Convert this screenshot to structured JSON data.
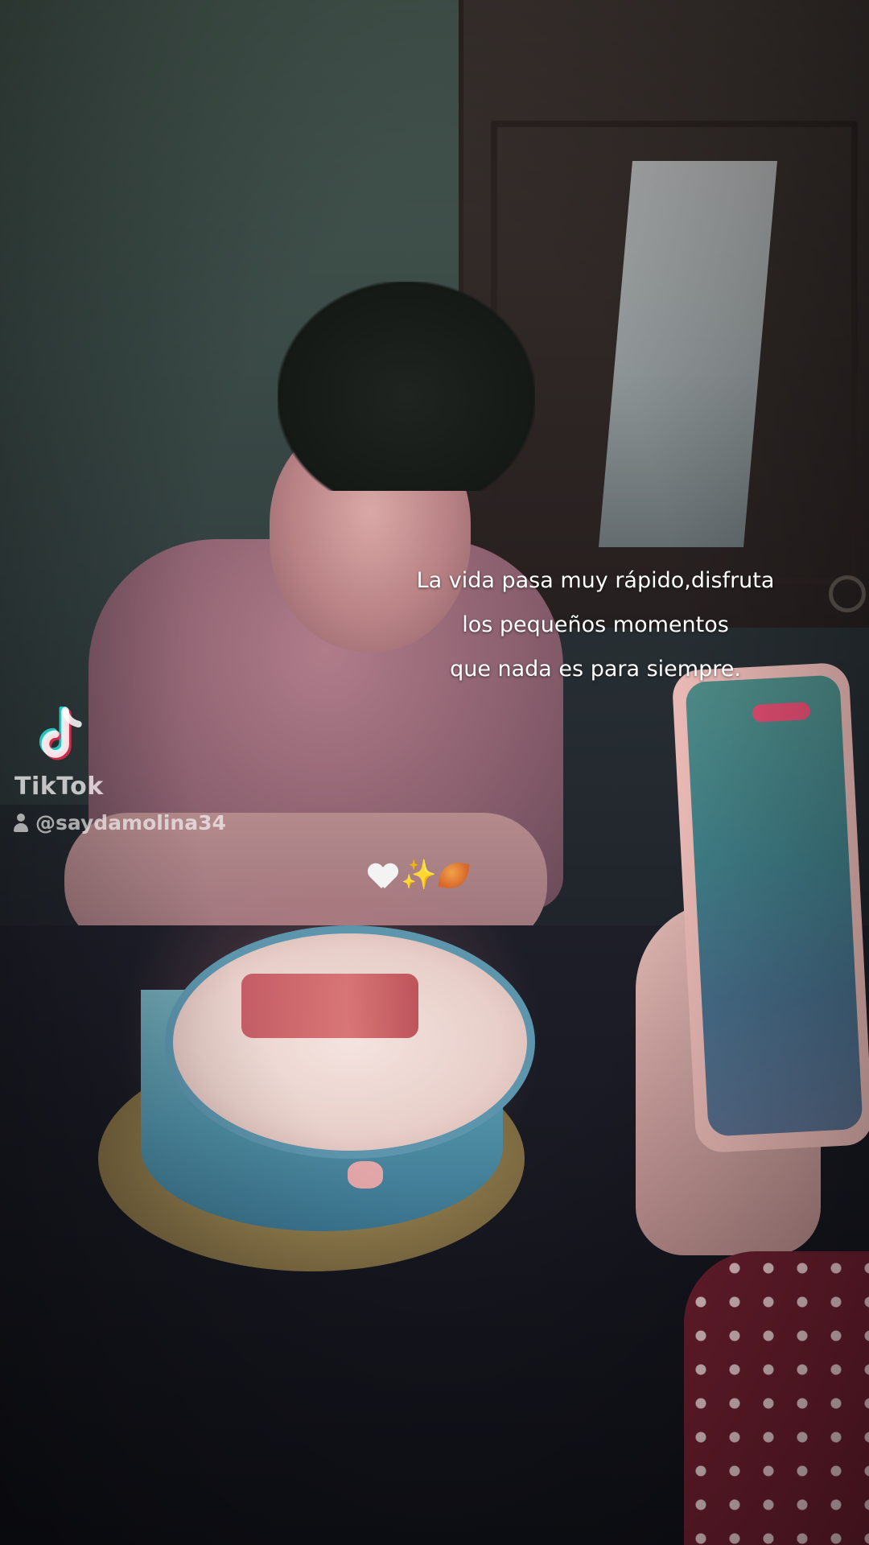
{
  "caption": {
    "lines": [
      "La vida pasa muy rápido,disfruta",
      "los pequeños momentos",
      "que nada es para siempre."
    ]
  },
  "emojis": [
    "white-heart",
    "sparkles",
    "fallen-leaf"
  ],
  "watermark": {
    "brand": "TikTok",
    "username": "@saydamolina34"
  },
  "colors": {
    "caption_text": "#ffffff",
    "tiktok_cyan": "#25f4ee",
    "tiktok_pink": "#fe2c55"
  }
}
